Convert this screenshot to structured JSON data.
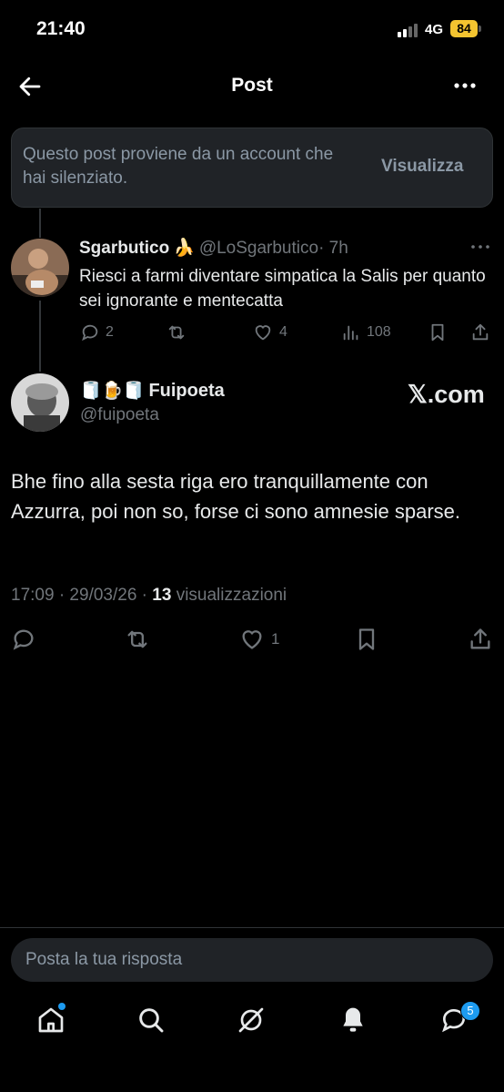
{
  "status_bar": {
    "time": "21:40",
    "network": "4G",
    "battery": "84"
  },
  "header": {
    "title": "Post",
    "back_icon": "back-arrow-icon",
    "more_icon": "more-dots-icon"
  },
  "muted_notice": {
    "text": "Questo post proviene da un account che hai silenziato.",
    "action": "Visualizza"
  },
  "reply_tweet": {
    "display_name": "Sgarbutico",
    "emoji": "🍌",
    "handle": "@LoSgarbutico",
    "time": "· 7h",
    "text": "Riesci a farmi diventare simpatica la Salis per quanto sei ignorante e mentecatta",
    "replies": "2",
    "retweets": "",
    "likes": "4",
    "views": "108"
  },
  "main_tweet": {
    "emoji_prefix": "🧻🍺🧻",
    "display_name": "Fuipoeta",
    "handle": "@fuipoeta",
    "watermark": "𝕏.com",
    "text": "Bhe fino alla sesta riga ero tranquillamente con Azzurra, poi non so, forse ci sono amnesie sparse.",
    "timestamp": "17:09 · 29/03/26 · ",
    "views_count": "13",
    "views_label": "visualizzazioni",
    "likes": "1"
  },
  "compose": {
    "placeholder": "Posta la tua risposta"
  },
  "bottom_nav": {
    "items": [
      "home-icon",
      "search-icon",
      "grok-icon",
      "notifications-icon",
      "messages-icon"
    ],
    "messages_badge": "5"
  },
  "colors": {
    "accent": "#1d9bf0",
    "background": "#000000",
    "muted_text": "#71767b",
    "battery": "#f4c430"
  }
}
